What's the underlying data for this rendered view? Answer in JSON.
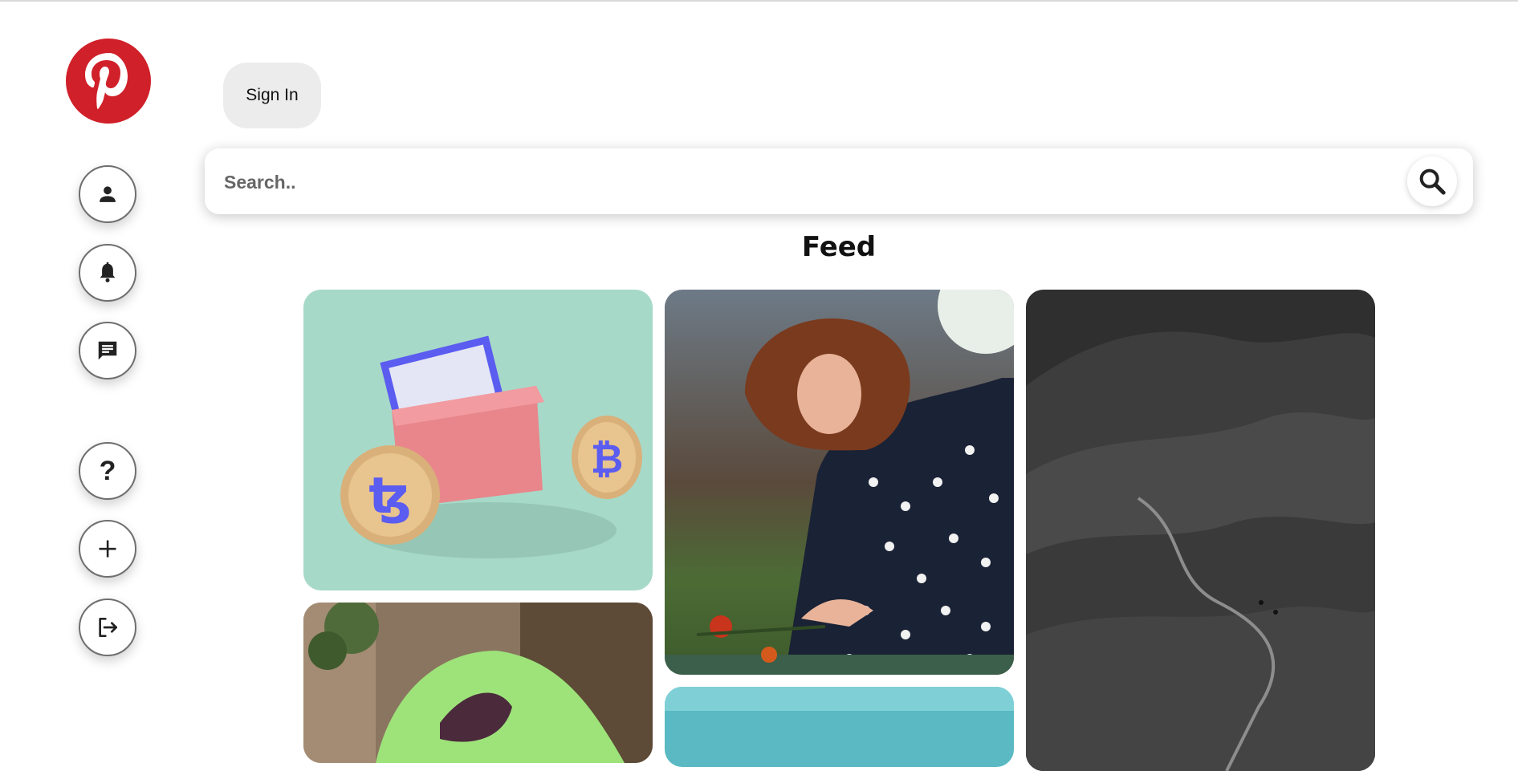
{
  "window": {
    "title": "Pinterest"
  },
  "sidebar": {
    "logo_icon": "pinterest-logo",
    "brand_color": "#d0202a",
    "items": [
      {
        "name": "profile",
        "icon": "person-icon"
      },
      {
        "name": "notifications",
        "icon": "bell-icon"
      },
      {
        "name": "messages",
        "icon": "chat-icon"
      },
      {
        "name": "help",
        "icon": "question-icon",
        "glyph": "?"
      },
      {
        "name": "create",
        "icon": "plus-icon",
        "glyph": "+"
      },
      {
        "name": "logout",
        "icon": "logout-icon"
      }
    ]
  },
  "header": {
    "signin_label": "Sign In",
    "search_placeholder": "Search..",
    "search_icon": "search-icon"
  },
  "feed": {
    "title": "Feed",
    "pins": [
      {
        "subject": "crypto wallet with coins"
      },
      {
        "subject": "woman in polka dot dress arranging roses"
      },
      {
        "subject": "black and white hills with hikers"
      },
      {
        "subject": "green mesh bag with produce"
      },
      {
        "subject": "turquoise water"
      }
    ]
  }
}
